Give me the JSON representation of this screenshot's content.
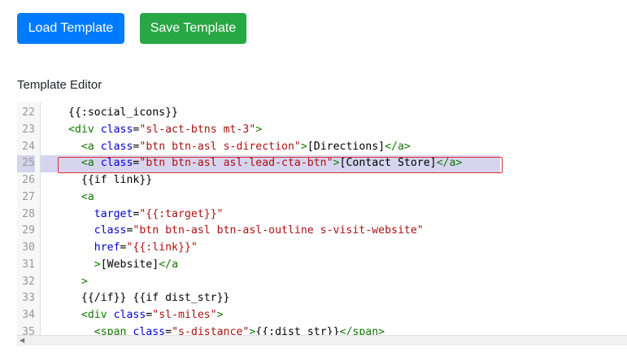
{
  "buttons": {
    "load_label": "Load Template",
    "save_label": "Save Template"
  },
  "section_label": "Template Editor",
  "editor": {
    "active_line": 25,
    "lines": [
      {
        "n": "22",
        "tokens": [
          {
            "t": "txt",
            "v": "{{:social_icons}}"
          }
        ]
      },
      {
        "n": "23",
        "tokens": [
          {
            "t": "tag",
            "v": "<div "
          },
          {
            "t": "attr",
            "v": "class"
          },
          {
            "t": "txt",
            "v": "="
          },
          {
            "t": "str",
            "v": "\"sl-act-btns mt-3\""
          },
          {
            "t": "tag",
            "v": ">"
          }
        ]
      },
      {
        "n": "24",
        "tokens": [
          {
            "t": "txt",
            "v": "  "
          },
          {
            "t": "tag",
            "v": "<a "
          },
          {
            "t": "attr",
            "v": "class"
          },
          {
            "t": "txt",
            "v": "="
          },
          {
            "t": "str",
            "v": "\"btn btn-asl s-direction\""
          },
          {
            "t": "tag",
            "v": ">"
          },
          {
            "t": "txt",
            "v": "[Directions]"
          },
          {
            "t": "tag",
            "v": "</a>"
          }
        ]
      },
      {
        "n": "25",
        "tokens": [
          {
            "t": "txt",
            "v": "  "
          },
          {
            "t": "tag",
            "v": "<a "
          },
          {
            "t": "attr",
            "v": "class"
          },
          {
            "t": "txt",
            "v": "="
          },
          {
            "t": "str",
            "v": "\"btn btn-asl asl-lead-cta-btn\""
          },
          {
            "t": "tag",
            "v": ">"
          },
          {
            "t": "txt",
            "v": "[Contact Store]"
          },
          {
            "t": "tag",
            "v": "</a>"
          }
        ]
      },
      {
        "n": "26",
        "tokens": [
          {
            "t": "txt",
            "v": "  {{if link}}"
          }
        ]
      },
      {
        "n": "27",
        "tokens": [
          {
            "t": "txt",
            "v": "  "
          },
          {
            "t": "tag",
            "v": "<a"
          }
        ]
      },
      {
        "n": "28",
        "tokens": [
          {
            "t": "txt",
            "v": "    "
          },
          {
            "t": "attr",
            "v": "target"
          },
          {
            "t": "txt",
            "v": "="
          },
          {
            "t": "str",
            "v": "\"{{:target}}\""
          }
        ]
      },
      {
        "n": "29",
        "tokens": [
          {
            "t": "txt",
            "v": "    "
          },
          {
            "t": "attr",
            "v": "class"
          },
          {
            "t": "txt",
            "v": "="
          },
          {
            "t": "str",
            "v": "\"btn btn-asl btn-asl-outline s-visit-website\""
          }
        ]
      },
      {
        "n": "30",
        "tokens": [
          {
            "t": "txt",
            "v": "    "
          },
          {
            "t": "attr",
            "v": "href"
          },
          {
            "t": "txt",
            "v": "="
          },
          {
            "t": "str",
            "v": "\"{{:link}}\""
          }
        ]
      },
      {
        "n": "31",
        "tokens": [
          {
            "t": "txt",
            "v": "    "
          },
          {
            "t": "tag",
            "v": ">"
          },
          {
            "t": "txt",
            "v": "[Website]"
          },
          {
            "t": "tag",
            "v": "</a"
          }
        ]
      },
      {
        "n": "32",
        "tokens": [
          {
            "t": "txt",
            "v": "  "
          },
          {
            "t": "tag",
            "v": ">"
          }
        ]
      },
      {
        "n": "33",
        "tokens": [
          {
            "t": "txt",
            "v": "  {{/if}} {{if dist_str}}"
          }
        ]
      },
      {
        "n": "34",
        "tokens": [
          {
            "t": "txt",
            "v": "  "
          },
          {
            "t": "tag",
            "v": "<div "
          },
          {
            "t": "attr",
            "v": "class"
          },
          {
            "t": "txt",
            "v": "="
          },
          {
            "t": "str",
            "v": "\"sl-miles\""
          },
          {
            "t": "tag",
            "v": ">"
          }
        ]
      },
      {
        "n": "35",
        "tokens": [
          {
            "t": "txt",
            "v": "    "
          },
          {
            "t": "tag",
            "v": "<span "
          },
          {
            "t": "attr",
            "v": "class"
          },
          {
            "t": "txt",
            "v": "="
          },
          {
            "t": "str",
            "v": "\"s-distance\""
          },
          {
            "t": "tag",
            "v": ">"
          },
          {
            "t": "txt",
            "v": "{{:dist_str}}"
          },
          {
            "t": "tag",
            "v": "</span>"
          }
        ]
      }
    ]
  },
  "scrollbar": {
    "left_arrow_icon": "arrow-left-icon",
    "left_arrow_glyph": "◀"
  },
  "colors": {
    "load_button": "#007bff",
    "save_button": "#28a745",
    "highlight_border": "#e03030",
    "active_line_bg": "#d7d4f0"
  }
}
